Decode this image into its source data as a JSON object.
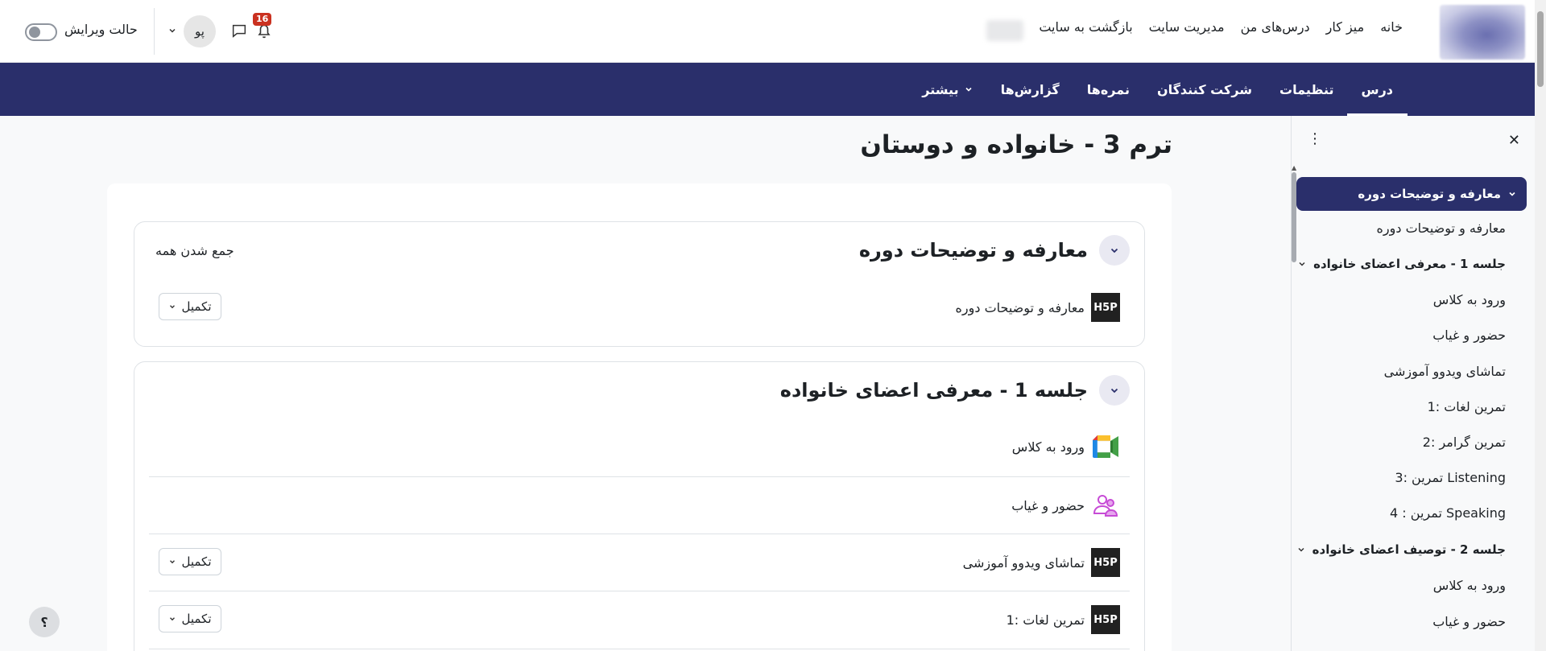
{
  "topbar": {
    "nav": [
      "خانه",
      "میز کار",
      "درس‌های من",
      "مدیریت سایت",
      "بازگشت به سایت"
    ],
    "notification_count": "16",
    "avatar_initials": "پو",
    "edit_mode_label": "حالت ویرایش"
  },
  "secnav": {
    "items": [
      "درس",
      "تنظیمات",
      "شرکت کنندگان",
      "نمره‌ها",
      "گزارش‌ها"
    ],
    "more_label": "بیشتر"
  },
  "drawer": {
    "active_section": "معارفه و توضیحات دوره",
    "items": [
      "معارفه و توضیحات دوره",
      "جلسه 1 - معرفی اعضای خانواده",
      "ورود به کلاس",
      "حضور و غیاب",
      "تماشای ویدوو آموزشی",
      "1: تمرین لغات",
      "2: تمرین گرامر",
      "3: تمرین Listening",
      "4 : تمرین Speaking",
      "جلسه 2 - توصیف اعضای خانواده",
      "ورود به کلاس",
      "حضور و غیاب"
    ]
  },
  "main": {
    "page_title": "ترم 3 - خانواده و دوستان",
    "collapse_all": "جمع شدن همه",
    "section1": {
      "title": "معارفه و توضیحات دوره",
      "activity": "معارفه و توضیحات دوره",
      "complete_label": "تکمیل"
    },
    "section2": {
      "title": "جلسه 1 - معرفی اعضای خانواده",
      "activities": [
        "ورود به کلاس",
        "حضور و غیاب",
        "تماشای ویدوو آموزشی",
        "1: تمرین لغات"
      ],
      "complete_label": "تکمیل"
    }
  },
  "icons": {
    "h5p_text": "H5P"
  },
  "help_label": "؟"
}
